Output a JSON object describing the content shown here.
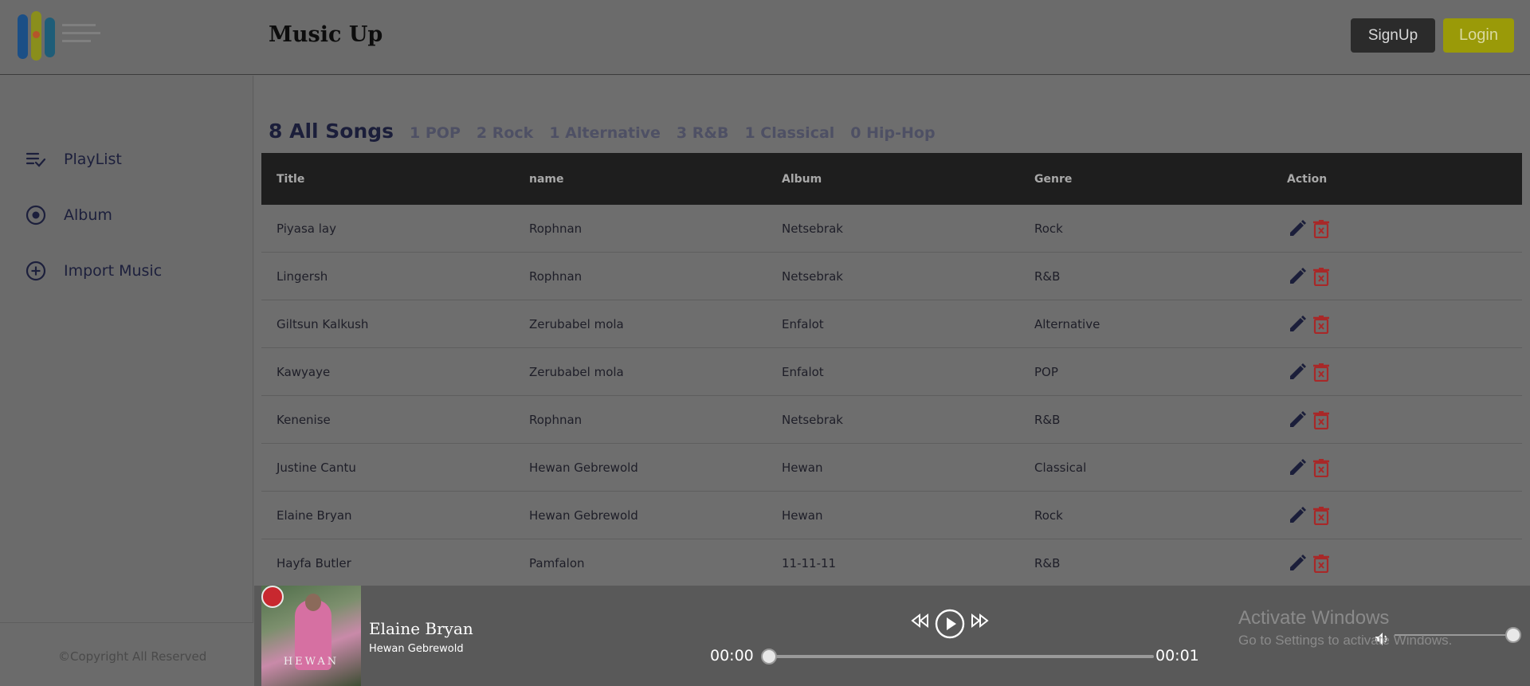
{
  "header": {
    "title": "Music Up",
    "signup_label": "SignUp",
    "login_label": "Login"
  },
  "sidebar": {
    "items": [
      {
        "label": "PlayList",
        "icon": "playlist-icon"
      },
      {
        "label": "Album",
        "icon": "album-icon"
      },
      {
        "label": "Import Music",
        "icon": "add-circle-icon"
      }
    ],
    "copyright": "©Copyright All Reserved"
  },
  "tabs": [
    {
      "label": "8 All Songs",
      "active": true
    },
    {
      "label": "1 POP"
    },
    {
      "label": "2 Rock"
    },
    {
      "label": "1 Alternative"
    },
    {
      "label": "3 R&B"
    },
    {
      "label": "1 Classical"
    },
    {
      "label": "0 Hip-Hop"
    }
  ],
  "table": {
    "columns": [
      "Title",
      "name",
      "Album",
      "Genre",
      "Action"
    ],
    "rows": [
      {
        "title": "Piyasa lay",
        "name": "Rophnan",
        "album": "Netsebrak",
        "genre": "Rock"
      },
      {
        "title": "Lingersh",
        "name": "Rophnan",
        "album": "Netsebrak",
        "genre": "R&B"
      },
      {
        "title": "Giltsun Kalkush",
        "name": "Zerubabel mola",
        "album": "Enfalot",
        "genre": "Alternative"
      },
      {
        "title": "Kawyaye",
        "name": "Zerubabel mola",
        "album": "Enfalot",
        "genre": "POP"
      },
      {
        "title": "Kenenise",
        "name": "Rophnan",
        "album": "Netsebrak",
        "genre": "R&B"
      },
      {
        "title": "Justine Cantu",
        "name": "Hewan Gebrewold",
        "album": "Hewan",
        "genre": "Classical"
      },
      {
        "title": "Elaine Bryan",
        "name": "Hewan Gebrewold",
        "album": "Hewan",
        "genre": "Rock"
      },
      {
        "title": "Hayfa Butler",
        "name": "Pamfalon",
        "album": "11-11-11",
        "genre": "R&B"
      }
    ],
    "icons": {
      "edit": "edit-pencil-icon",
      "delete": "delete-trash-icon"
    },
    "colors": {
      "edit": "#1b1e3a",
      "delete": "#a82828"
    }
  },
  "player": {
    "cover_text": "HEWAN",
    "song_title": "Elaine Bryan",
    "song_artist": "Hewan Gebrewold",
    "time_current": "00:00",
    "time_total": "00:01",
    "progress": 0.0,
    "volume": 1.0
  },
  "watermark": {
    "line1": "Activate Windows",
    "line2": "Go to Settings to activate Windows."
  },
  "colors": {
    "accent": "#9a9a08",
    "header_table": "#1e1e1e",
    "background": "#6b6b6b"
  }
}
